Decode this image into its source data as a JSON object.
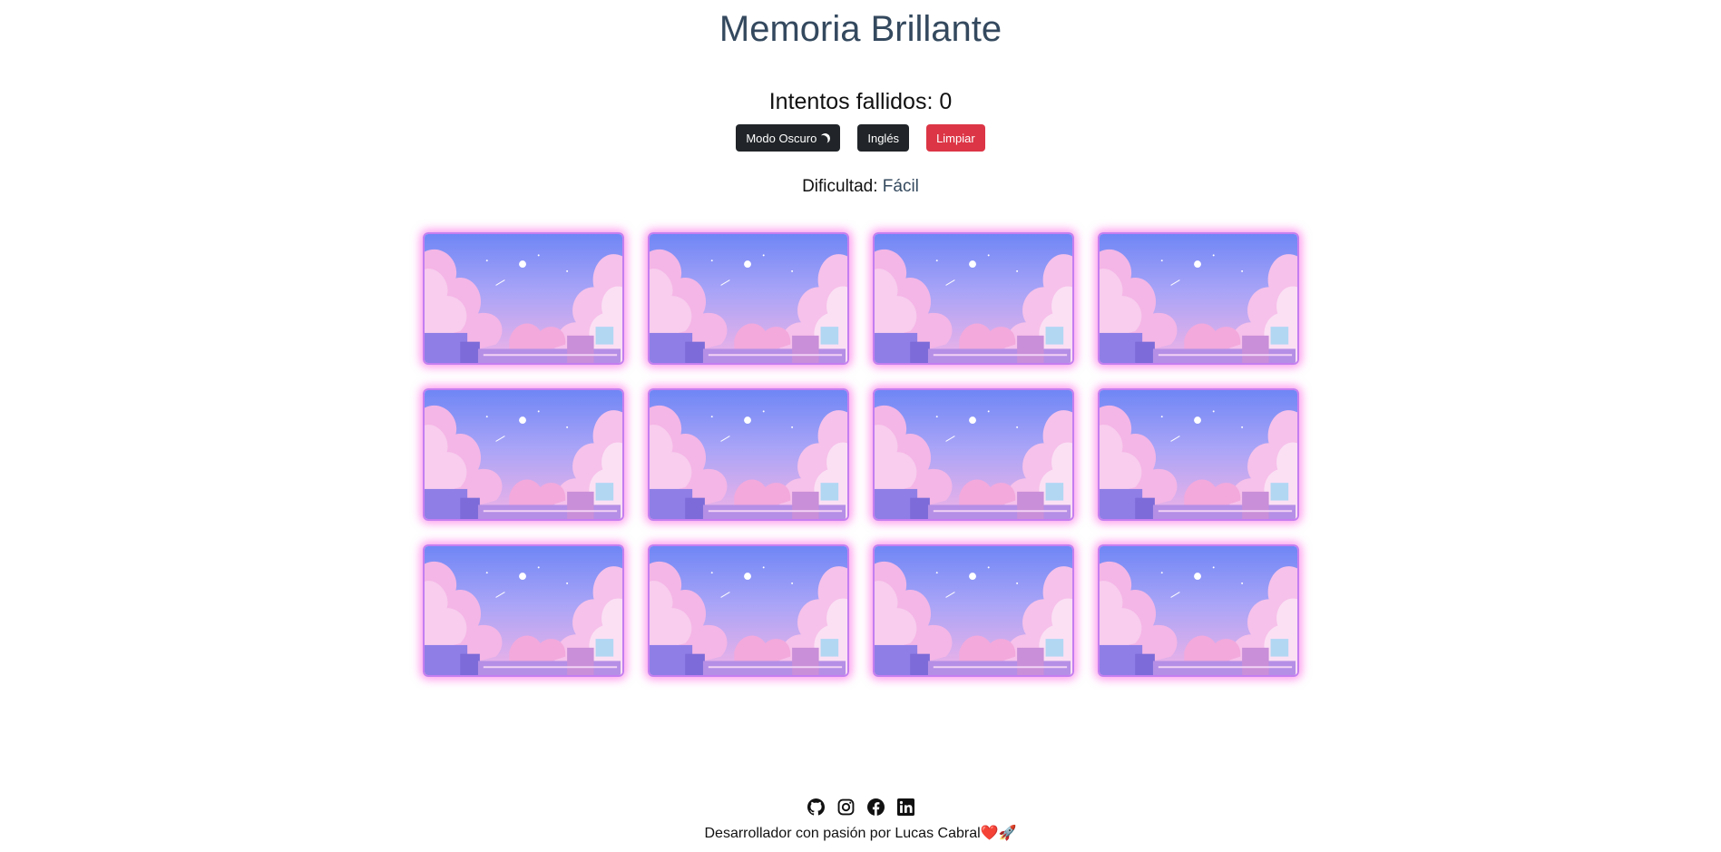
{
  "header": {
    "title": "Memoria Brillante"
  },
  "stats": {
    "failed_label": "Intentos fallidos:",
    "failed_count": "0"
  },
  "buttons": {
    "dark_mode": "Modo Oscuro",
    "language": "Inglés",
    "clear": "Limpiar"
  },
  "difficulty": {
    "label": "Dificultad:",
    "level": "Fácil"
  },
  "board": {
    "rows": 3,
    "columns": 4,
    "cards": [
      {
        "state": "face-down"
      },
      {
        "state": "face-down"
      },
      {
        "state": "face-down"
      },
      {
        "state": "face-down"
      },
      {
        "state": "face-down"
      },
      {
        "state": "face-down"
      },
      {
        "state": "face-down"
      },
      {
        "state": "face-down"
      },
      {
        "state": "face-down"
      },
      {
        "state": "face-down"
      },
      {
        "state": "face-down"
      },
      {
        "state": "face-down"
      }
    ]
  },
  "footer": {
    "icons": [
      "github-icon",
      "instagram-icon",
      "facebook-icon",
      "linkedin-icon"
    ],
    "text": "Desarrollador con pasión por Lucas Cabral",
    "heart": "❤️",
    "rocket": "🚀"
  },
  "colors": {
    "title": "#34495e",
    "dark_button": "#212529",
    "clear_button": "#dc3545",
    "card_glow": "#ff78e6",
    "card_border": "#c47ef0"
  }
}
